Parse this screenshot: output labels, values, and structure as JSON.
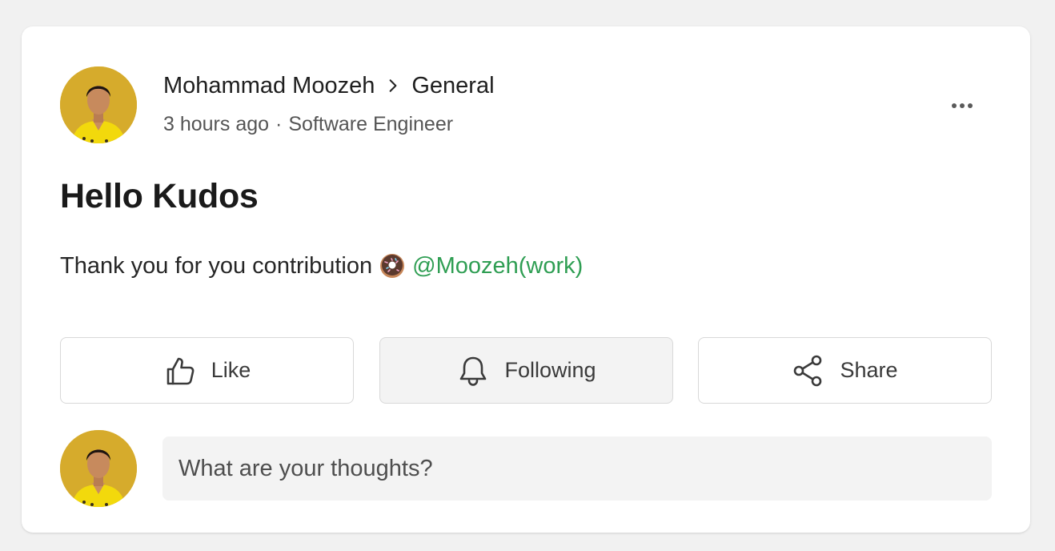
{
  "post": {
    "author": "Mohammad Moozeh",
    "channel": "General",
    "time": "3 hours ago",
    "separator": "·",
    "role": "Software Engineer",
    "title": "Hello Kudos",
    "body_text": "Thank you for you contribution",
    "emoji_icon": "donut-icon",
    "mention": "@Moozeh(work)"
  },
  "actions": {
    "like_label": "Like",
    "follow_label": "Following",
    "share_label": "Share"
  },
  "comment": {
    "placeholder": "What are your thoughts?"
  },
  "colors": {
    "mention": "#2f9e53",
    "avatar_bg": "#d4a92a",
    "card_bg": "#ffffff",
    "page_bg": "#f1f1f1"
  }
}
